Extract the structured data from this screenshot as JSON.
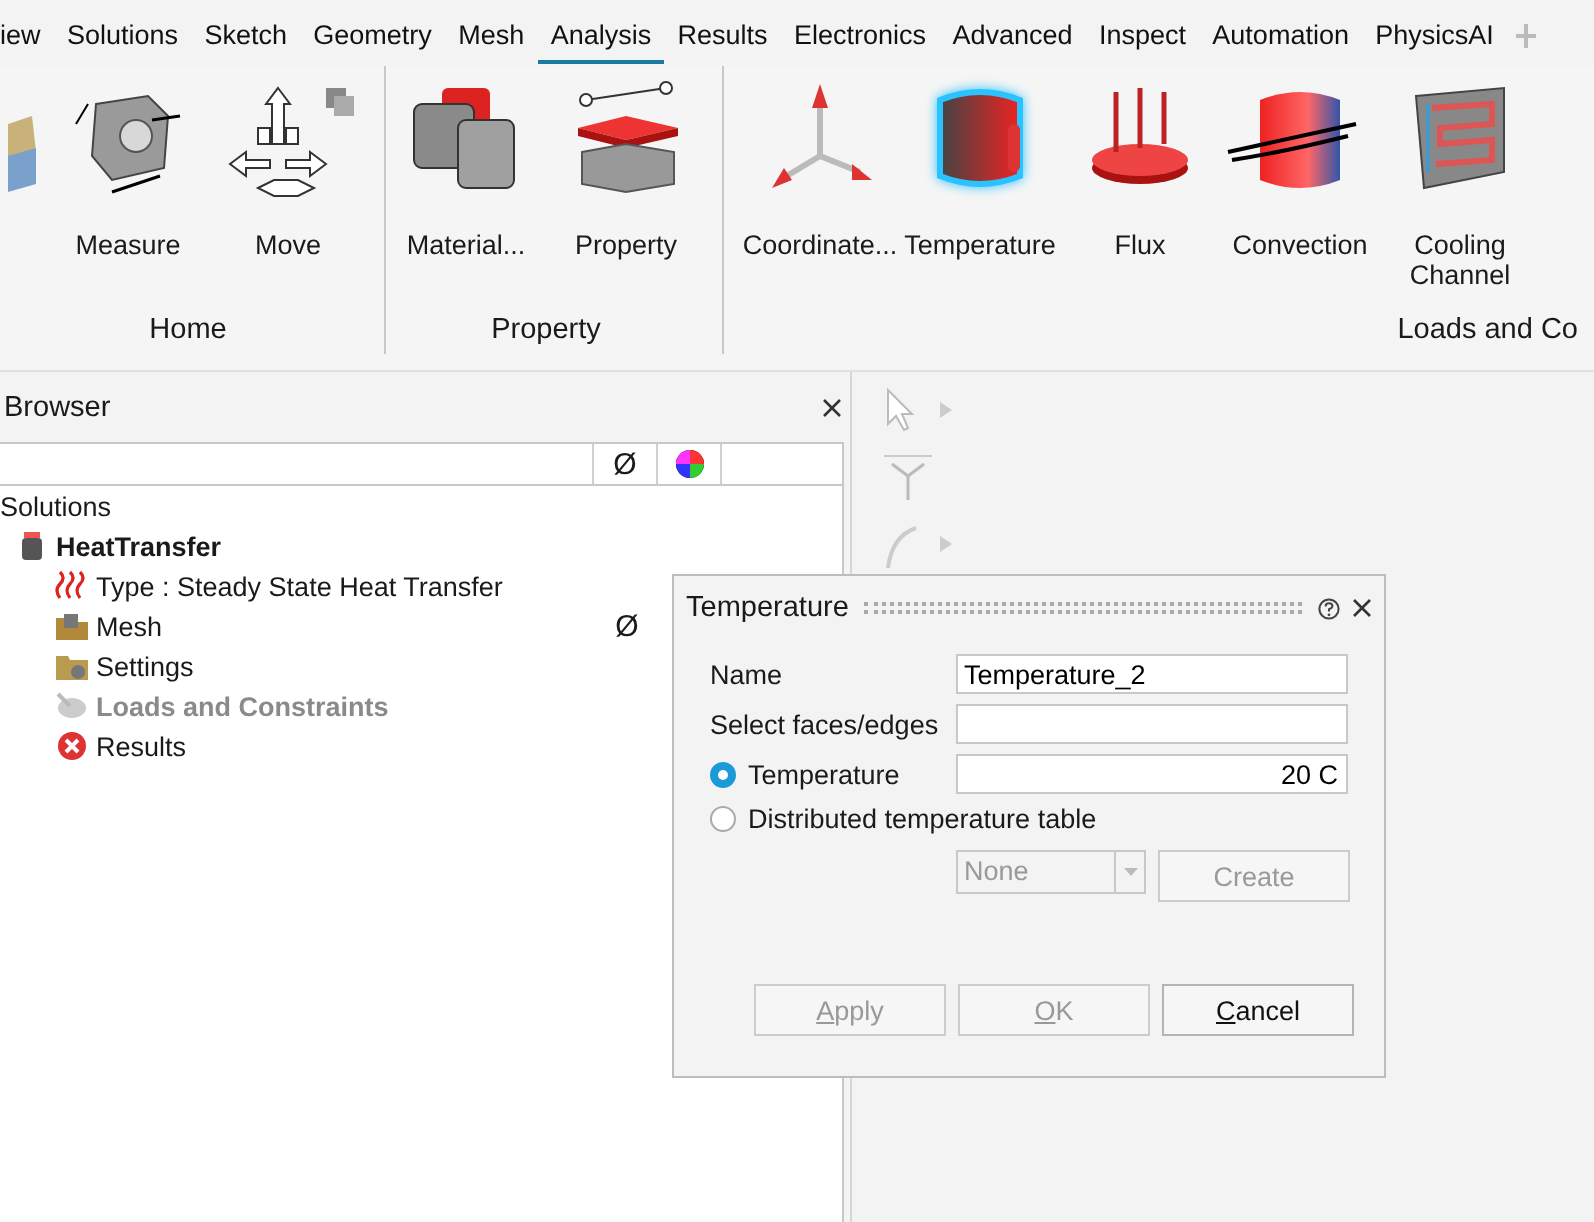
{
  "menu_tabs": [
    {
      "label": "iew",
      "selected": false
    },
    {
      "label": "Solutions",
      "selected": false
    },
    {
      "label": "Sketch",
      "selected": false
    },
    {
      "label": "Geometry",
      "selected": false
    },
    {
      "label": "Mesh",
      "selected": false
    },
    {
      "label": "Analysis",
      "selected": true
    },
    {
      "label": "Results",
      "selected": false
    },
    {
      "label": "Electronics",
      "selected": false
    },
    {
      "label": "Advanced",
      "selected": false
    },
    {
      "label": "Inspect",
      "selected": false
    },
    {
      "label": "Automation",
      "selected": false
    },
    {
      "label": "PhysicsAI",
      "selected": false
    }
  ],
  "ribbon": [
    {
      "label": "Home",
      "tools": [
        {
          "kind": "partial"
        },
        {
          "kind": "measure",
          "label": "Measure"
        },
        {
          "kind": "move",
          "label": "Move"
        }
      ]
    },
    {
      "label": "Property",
      "tools": [
        {
          "kind": "material",
          "label": "Material..."
        },
        {
          "kind": "property",
          "label": "Property"
        }
      ]
    },
    {
      "label": "Loads and Co",
      "tools": [
        {
          "kind": "coordinate",
          "label": "Coordinate..."
        },
        {
          "kind": "temperature",
          "label": "Temperature",
          "selected": true
        },
        {
          "kind": "flux",
          "label": "Flux",
          "selected": false
        },
        {
          "kind": "convection",
          "label": "Convection",
          "selected": false
        },
        {
          "kind": "cooling",
          "label": "Cooling Channel",
          "selected": false
        }
      ]
    }
  ],
  "browser": {
    "title": "Browser",
    "columns": [
      {
        "kind": "text",
        "label": "Ø"
      },
      {
        "kind": "color"
      }
    ],
    "tree": [
      {
        "label": "Solutions",
        "children": [
          {
            "label": "HeatTransfer",
            "kind": "solution",
            "bold": true,
            "children": [
              {
                "label": "Type : Steady State Heat Transfer",
                "kind": "type",
                "disabled": false
              },
              {
                "label": "Mesh",
                "kind": "mesh",
                "disabled": false,
                "column_1": "Ø"
              },
              {
                "label": "Settings",
                "kind": "settings",
                "disabled": false
              },
              {
                "label": "Loads and Constraints",
                "kind": "loads",
                "disabled": true,
                "bold": true
              },
              {
                "label": "Results",
                "kind": "results",
                "disabled": false
              }
            ]
          }
        ]
      }
    ]
  },
  "dialog": {
    "title": "Temperature",
    "name": {
      "label": "Name",
      "value": "Temperature_2"
    },
    "selection": {
      "label": "Select faces/edges"
    },
    "options": [
      {
        "label": "Temperature",
        "selected": true,
        "value": "20 C"
      },
      {
        "label": "Distributed temperature table",
        "selected": false
      }
    ],
    "table_select": {
      "value": "None",
      "disabled": true
    },
    "create_button": {
      "label": "Create",
      "disabled": true
    },
    "buttons": [
      {
        "label": "Apply",
        "disabled": true
      },
      {
        "label": "OK",
        "disabled": true
      },
      {
        "label": "Cancel",
        "disabled": false
      }
    ]
  }
}
